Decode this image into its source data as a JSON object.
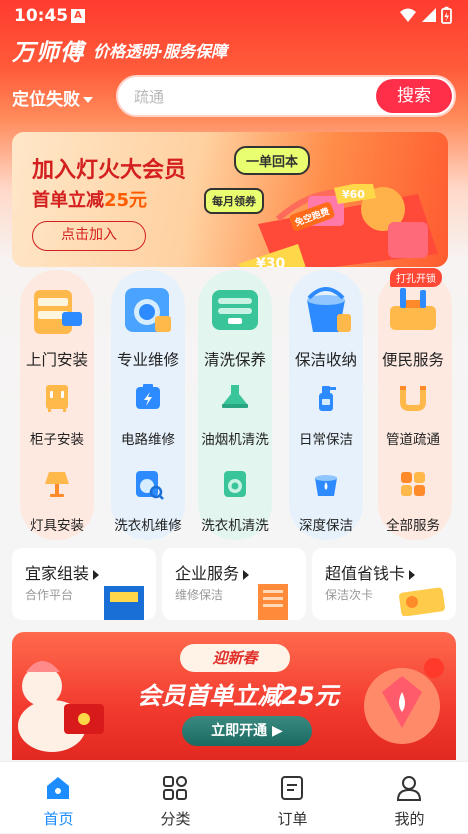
{
  "status_bar": {
    "time": "10:45",
    "notif_glyph": "A"
  },
  "brand": {
    "logo": "万师傅",
    "slogan": "价格透明·服务保障"
  },
  "location": {
    "label": "定位失败"
  },
  "search": {
    "placeholder": "疏通",
    "button": "搜索"
  },
  "banner": {
    "title": "加入灯火大会员",
    "subtitle_prefix": "首单立减",
    "subtitle_amount": "25元",
    "join_button": "点击加入",
    "tag_one": "一单回本",
    "tag_monthly": "每月领券",
    "tag_free": "免空跑费",
    "coupon_60": "¥60",
    "coupon_30": "¥30"
  },
  "hot_badge": "打孔开锁",
  "main_services": [
    {
      "label": "上门安装",
      "icon": "drawer-cabinet-icon"
    },
    {
      "label": "专业维修",
      "icon": "washing-machine-repair-icon"
    },
    {
      "label": "清洗保养",
      "icon": "cleaning-appliance-icon"
    },
    {
      "label": "保洁收纳",
      "icon": "bucket-icon"
    },
    {
      "label": "便民服务",
      "icon": "toolbox-icon"
    }
  ],
  "sub_services_row1": [
    {
      "label": "柜子安装",
      "icon": "cabinet-icon"
    },
    {
      "label": "电路维修",
      "icon": "battery-bolt-icon"
    },
    {
      "label": "油烟机清洗",
      "icon": "range-hood-icon"
    },
    {
      "label": "日常保洁",
      "icon": "spray-bottle-icon"
    },
    {
      "label": "管道疏通",
      "icon": "pipe-icon"
    }
  ],
  "sub_services_row2": [
    {
      "label": "灯具安装",
      "icon": "lamp-icon"
    },
    {
      "label": "洗衣机维修",
      "icon": "washer-search-icon"
    },
    {
      "label": "洗衣机清洗",
      "icon": "washer-icon"
    },
    {
      "label": "深度保洁",
      "icon": "bucket-drop-icon"
    },
    {
      "label": "全部服务",
      "icon": "grid-four-icon"
    }
  ],
  "cards": [
    {
      "title": "宜家组装",
      "sub": "合作平台"
    },
    {
      "title": "企业服务",
      "sub": "维修保洁"
    },
    {
      "title": "超值省钱卡",
      "sub": "保洁次卡"
    }
  ],
  "promo": {
    "pill": "迎新春",
    "title": "会员首单立减25元",
    "button": "立即开通"
  },
  "tabbar": [
    {
      "label": "首页",
      "icon": "home-icon"
    },
    {
      "label": "分类",
      "icon": "category-icon"
    },
    {
      "label": "订单",
      "icon": "order-icon"
    },
    {
      "label": "我的",
      "icon": "profile-icon"
    }
  ],
  "colors": {
    "accent": "#ff2f4a",
    "brand_red": "#ff3b2f",
    "tab_active": "#1d8cff"
  }
}
